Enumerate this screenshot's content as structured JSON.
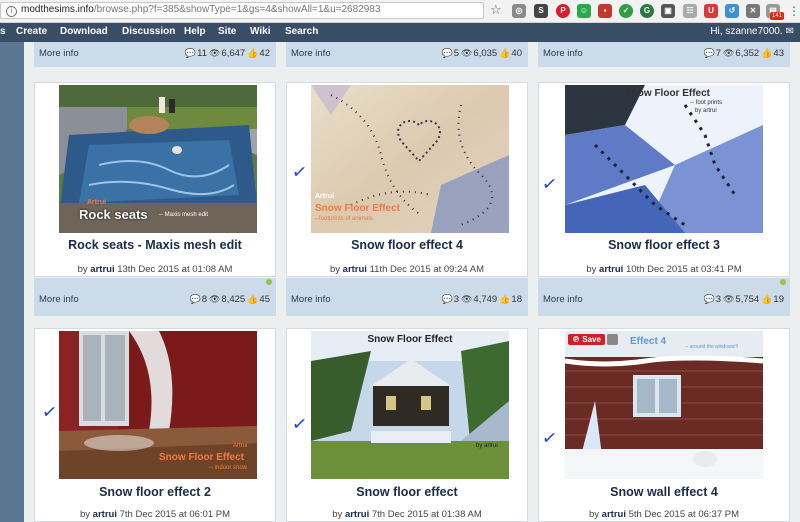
{
  "browser": {
    "url_host": "modthesims.info",
    "url_path": "/browse.php?f=385&showType=1&gs=4&showAll=1&u=2682983",
    "badge": "141"
  },
  "nav": {
    "items": [
      "Create",
      "Download",
      "Discussion",
      "Help",
      "Site",
      "Wiki",
      "Search"
    ],
    "greeting": "Hi, szanne7000."
  },
  "top_row": [
    {
      "more": "More info",
      "comments": "11",
      "views": "6,647",
      "thanks": "42"
    },
    {
      "more": "More info",
      "comments": "5",
      "views": "6,035",
      "thanks": "40"
    },
    {
      "more": "More info",
      "comments": "7",
      "views": "6,352",
      "thanks": "43"
    }
  ],
  "cards": [
    {
      "title": "Rock seats - Maxis mesh edit",
      "by": "by",
      "author": "artrui",
      "date": "13th Dec 2015 at 01:08 AM",
      "overlay": "Rock seats",
      "overlay_small": "-- Maxis mesh edit",
      "brand": "Artrui",
      "more": "More info",
      "comments": "8",
      "views": "8,425",
      "thanks": "45"
    },
    {
      "title": "Snow floor effect 4",
      "by": "by",
      "author": "artrui",
      "date": "11th Dec 2015 at 09:24 AM",
      "brand": "Artrui",
      "overlay": "Snow Floor Effect",
      "overlay_small": "--footprints of animals",
      "more": "More info",
      "comments": "3",
      "views": "4,749",
      "thanks": "18"
    },
    {
      "title": "Snow floor effect 3",
      "by": "by",
      "author": "artrui",
      "date": "10th Dec 2015 at 03:41 PM",
      "overlay": "Snow Floor Effect",
      "overlay_small": "-- foot prints",
      "brand": "by artrui",
      "more": "More info",
      "comments": "3",
      "views": "5,754",
      "thanks": "19"
    },
    {
      "title": "Snow floor effect 2",
      "by": "by",
      "author": "artrui",
      "date": "7th Dec 2015 at 06:01 PM",
      "overlay": "Snow Floor Effect",
      "overlay_small": "-- indoor snow",
      "brand": "Artrui"
    },
    {
      "title": "Snow floor effect",
      "by": "by",
      "author": "artrui",
      "date": "7th Dec 2015 at 01:38 AM",
      "overlay": "Snow Floor Effect",
      "brand": "by artrui"
    },
    {
      "title": "Snow wall effect 4",
      "by": "by",
      "author": "artrui",
      "date": "5th Dec 2015 at 06:37 PM",
      "overlay": "Effect 4",
      "overlay_small": "-- around the windows!!!",
      "save_label": "Save"
    }
  ],
  "checkmark": "✓",
  "colors": {
    "nav": "#3a4d66",
    "footer": "#ccdbea",
    "title": "#1b2b4a",
    "overlay": "#f07a45"
  }
}
